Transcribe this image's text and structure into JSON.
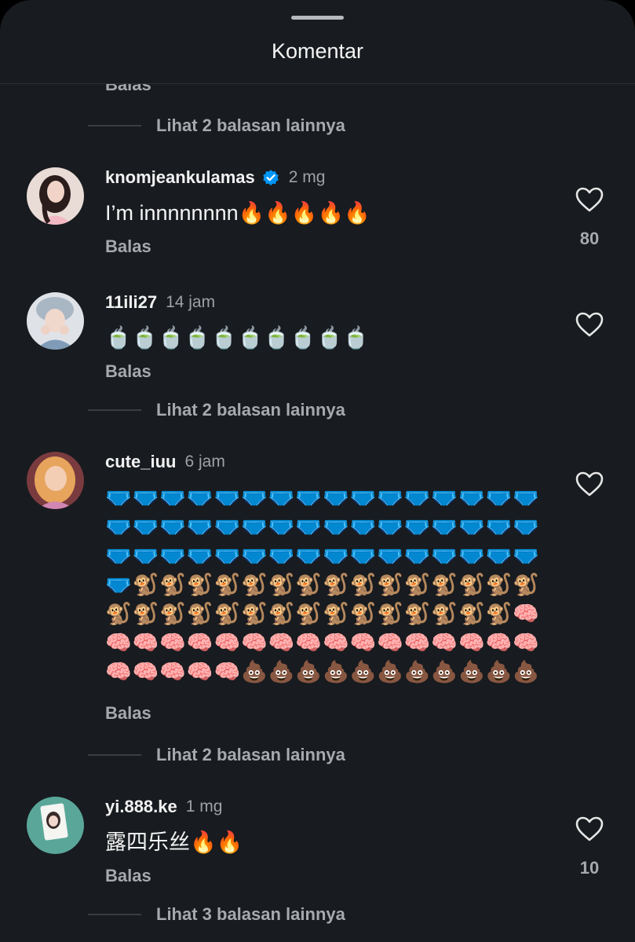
{
  "header": {
    "title": "Komentar"
  },
  "top_cut_reply": "Balas",
  "more_replies": [
    "Lihat 2 balasan lainnya",
    "Lihat 2 balasan lainnya",
    "Lihat 2 balasan lainnya",
    "Lihat 3 balasan lainnya"
  ],
  "comments": [
    {
      "username": "knomjeankulamas",
      "verified": true,
      "time": "2 mg",
      "text": "I’m innnnnnnn🔥🔥🔥🔥🔥",
      "reply": "Balas",
      "likes": "80",
      "avatar_color": "#e9d7d0"
    },
    {
      "username": "11ili27",
      "verified": false,
      "time": "14 jam",
      "text": "🍵🍵🍵🍵🍵🍵🍵🍵🍵🍵",
      "reply": "Balas",
      "likes": "",
      "avatar_color": "#d8dce2"
    },
    {
      "username": "cute_iuu",
      "verified": false,
      "time": "6 jam",
      "text": "🩲🩲🩲🩲🩲🩲🩲🩲🩲🩲🩲🩲🩲🩲🩲🩲🩲🩲🩲🩲🩲🩲🩲🩲🩲🩲🩲🩲🩲🩲🩲🩲🩲🩲🩲🩲🩲🩲🩲🩲🩲🩲🩲🩲🩲🩲🩲🩲🩲🐒🐒🐒🐒🐒🐒🐒🐒🐒🐒🐒🐒🐒🐒🐒🐒🐒🐒🐒🐒🐒🐒🐒🐒🐒🐒🐒🐒🐒🐒🧠🧠🧠🧠🧠🧠🧠🧠🧠🧠🧠🧠🧠🧠🧠🧠🧠🧠🧠🧠🧠🧠💩💩💩💩💩💩💩💩💩💩💩",
      "reply": "Balas",
      "likes": "",
      "avatar_color": "#c46a5a"
    },
    {
      "username": "yi.888.ke",
      "verified": false,
      "time": "1 mg",
      "text": "露四乐丝🔥🔥",
      "reply": "Balas",
      "likes": "10",
      "avatar_color": "#5aa79a"
    }
  ],
  "icons": {
    "heart": "heart-outline-icon",
    "verified": "verified-badge-icon"
  },
  "colors": {
    "background": "#181b1f",
    "secondary_text": "#a6a9ad",
    "verified_blue": "#0095f6"
  }
}
